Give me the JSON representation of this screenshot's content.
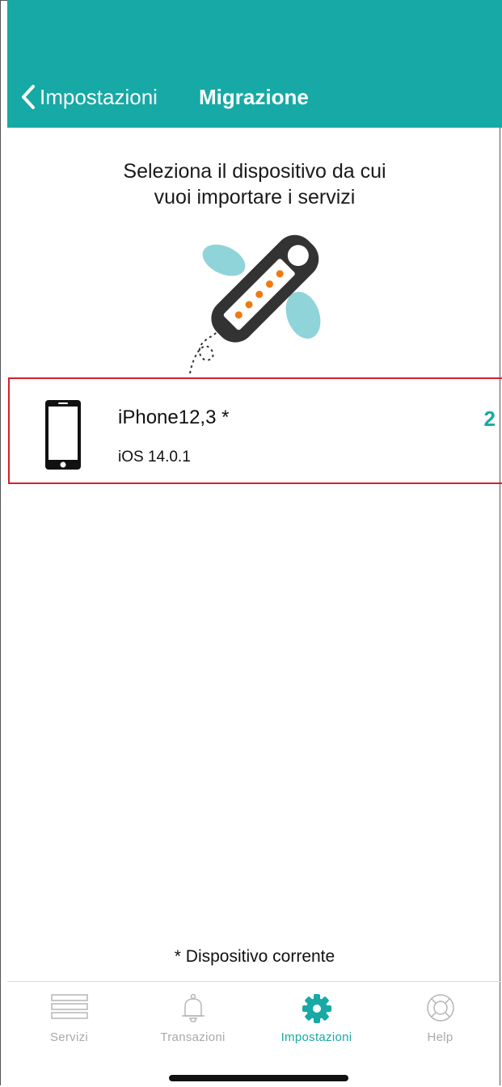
{
  "header": {
    "back_label": "Impostazioni",
    "title": "Migrazione",
    "bg_color": "#17a9a5"
  },
  "instruction": {
    "line1": "Seleziona il dispositivo da cui",
    "line2": "vuoi importare i servizi"
  },
  "device": {
    "name": "iPhone12,3 *",
    "os": "iOS 14.0.1",
    "count": "2",
    "icon": "smartphone-icon"
  },
  "footnote": "* Dispositivo corrente",
  "tabbar": {
    "items": [
      {
        "label": "Servizi",
        "icon": "list-icon",
        "active": false
      },
      {
        "label": "Transazioni",
        "icon": "bell-icon",
        "active": false
      },
      {
        "label": "Impostazioni",
        "icon": "gear-icon",
        "active": true
      },
      {
        "label": "Help",
        "icon": "lifebuoy-icon",
        "active": false
      }
    ]
  },
  "colors": {
    "accent": "#17a9a5",
    "selection_border": "#d42030",
    "inactive_tab": "#a9a9a9"
  }
}
